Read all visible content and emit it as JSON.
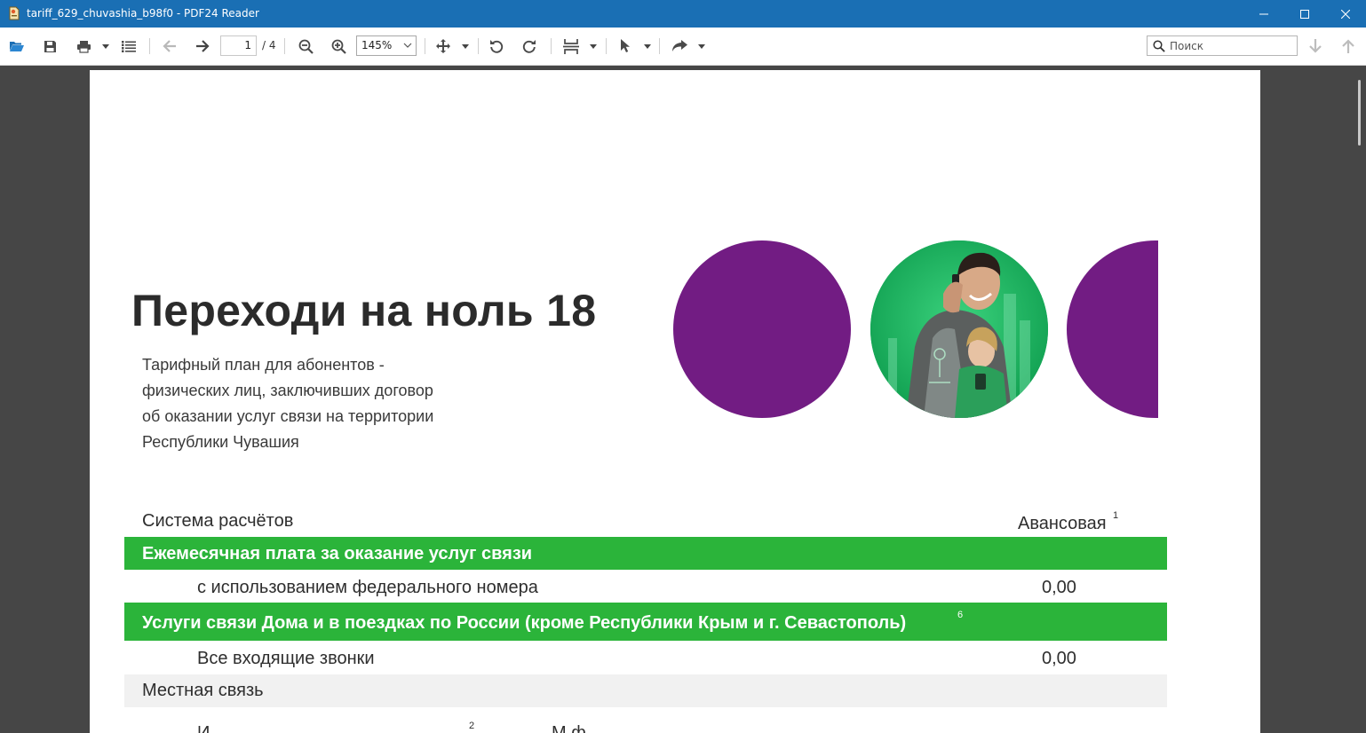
{
  "window": {
    "title": "tariff_629_chuvashia_b98f0 - PDF24 Reader"
  },
  "toolbar": {
    "current_page": "1",
    "page_total": "/ 4",
    "zoom": "145%",
    "search_placeholder": "Поиск",
    "icons": [
      "open-folder-icon",
      "save-icon",
      "print-icon",
      "print-dropdown-icon",
      "list-icon",
      "back-arrow-icon",
      "forward-arrow-icon",
      "zoom-out-icon",
      "zoom-in-icon",
      "move-icon",
      "rotate-left-icon",
      "rotate-right-icon",
      "fit-icon",
      "select-pointer-icon",
      "share-icon",
      "search-next-icon",
      "search-prev-icon"
    ]
  },
  "document": {
    "title": "Переходи на ноль 18",
    "subtitle_lines": [
      "Тарифный план для абонентов -",
      "физических лиц, заключивших договор",
      "об оказании услуг связи на территории",
      "Республики Чувашия"
    ],
    "billing_label": "Система расчётов",
    "billing_value": "Авансовая",
    "billing_sup": "1",
    "section1_title": "Ежемесячная плата за оказание услуг связи",
    "row1_label": "с использованием федерального номера",
    "row1_value": "0,00",
    "section2_title": "Услуги связи Дома и в поездках по России (кроме Республики Крым и г. Севастополь)",
    "section2_sup": "6",
    "row2_label": "Все входящие звонки",
    "row2_value": "0,00",
    "section3_title": "Местная связь",
    "cut_text_left": "И",
    "cut_sup": "2",
    "cut_text_mid": "М  ф"
  },
  "colors": {
    "titlebar": "#1a6fb4",
    "brand_purple": "#721c83",
    "brand_green": "#2bb43a",
    "viewer_bg": "#464646"
  }
}
